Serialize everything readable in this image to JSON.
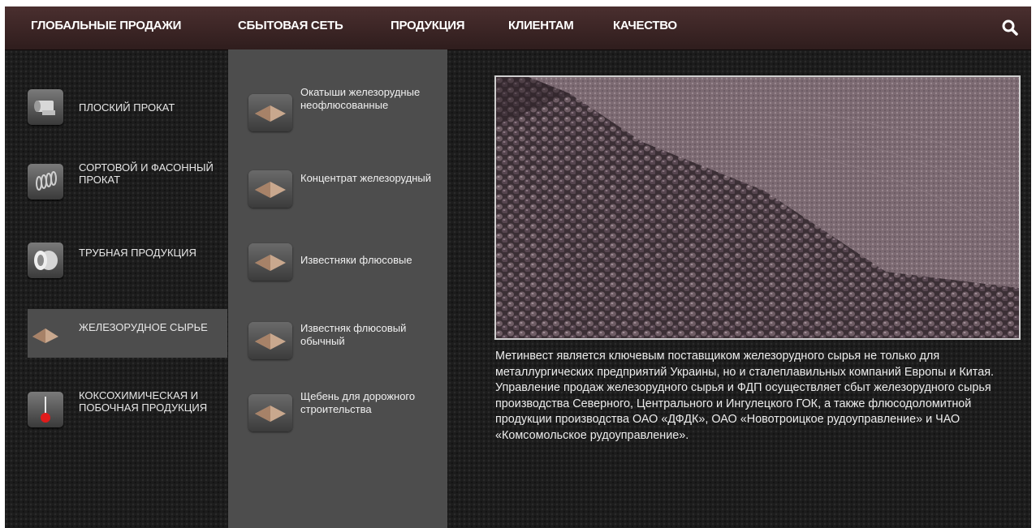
{
  "nav": {
    "items": [
      "ГЛОБАЛЬНЫЕ ПРОДАЖИ",
      "СБЫТОВАЯ СЕТЬ",
      "ПРОДУКЦИЯ",
      "КЛИЕНТАМ",
      "КАЧЕСТВО"
    ],
    "search_icon": "search-icon"
  },
  "categories": [
    {
      "label": "ПЛОСКИЙ ПРОКАТ",
      "icon": "flat-steel-icon"
    },
    {
      "label": "СОРТОВОЙ И ФАСОННЫЙ ПРОКАТ",
      "icon": "coil-steel-icon"
    },
    {
      "label": "ТРУБНАЯ ПРОДУКЦИЯ",
      "icon": "pipe-icon"
    },
    {
      "label": "ЖЕЛЕЗОРУДНОЕ СЫРЬЕ",
      "icon": "iron-ore-icon",
      "active": true
    },
    {
      "label": "КОКСОХИМИЧЕСКАЯ И ПОБОЧНАЯ ПРОДУКЦИЯ",
      "icon": "coke-chemical-icon"
    }
  ],
  "subcategories": [
    {
      "label": "Окатыши железорудные неофлюсованные",
      "icon": "iron-ore-icon"
    },
    {
      "label": "Концентрат железорудный",
      "icon": "iron-ore-icon"
    },
    {
      "label": "Известняки флюсовые",
      "icon": "iron-ore-icon"
    },
    {
      "label": "Известняк флюсовый обычный",
      "icon": "iron-ore-icon"
    },
    {
      "label": "Щебень для дорожного строительства",
      "icon": "iron-ore-icon"
    }
  ],
  "content": {
    "description": "Метинвест является ключевым поставщиком железорудного сырья не только для металлургических предприятий Украины, но и сталеплавильных компаний Европы и Китая. Управление продаж железорудного сырья и ФДП осуществляет сбыт железорудного сырья производства Северного, Центрального и Ингулецкого ГОК, а также флюсодоломитной продукции производства ОАО «ДФДК», ОАО «Новотроицкое рудоуправление» и ЧАО «Комсомольское рудоуправление»."
  },
  "colors": {
    "nav_bg": "#3a2424",
    "panel_bg": "#4d4d4d",
    "page_bg": "#1c1c1c",
    "text": "#e6e6e6"
  }
}
